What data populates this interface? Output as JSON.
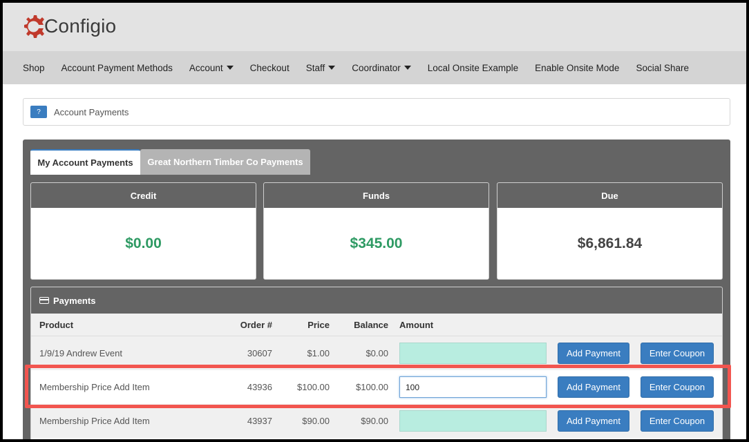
{
  "brand": {
    "name": "Configio",
    "color": "#c0392b"
  },
  "nav": {
    "items": [
      {
        "label": "Shop",
        "dropdown": false
      },
      {
        "label": "Account Payment Methods",
        "dropdown": false
      },
      {
        "label": "Account",
        "dropdown": true
      },
      {
        "label": "Checkout",
        "dropdown": false
      },
      {
        "label": "Staff",
        "dropdown": true
      },
      {
        "label": "Coordinator",
        "dropdown": true
      },
      {
        "label": "Local Onsite Example",
        "dropdown": false
      },
      {
        "label": "Enable Onsite Mode",
        "dropdown": false
      },
      {
        "label": "Social Share",
        "dropdown": false
      }
    ]
  },
  "breadcrumb": {
    "help": "?",
    "label": "Account Payments"
  },
  "tabs": [
    {
      "label": "My Account Payments",
      "active": true
    },
    {
      "label": "Great Northern Timber Co Payments",
      "active": false
    }
  ],
  "stats": {
    "credit": {
      "label": "Credit",
      "value": "$0.00"
    },
    "funds": {
      "label": "Funds",
      "value": "$345.00"
    },
    "due": {
      "label": "Due",
      "value": "$6,861.84"
    }
  },
  "payments": {
    "title": "Payments",
    "columns": {
      "product": "Product",
      "order": "Order #",
      "price": "Price",
      "balance": "Balance",
      "amount": "Amount"
    },
    "add_label": "Add Payment",
    "coupon_label": "Enter Coupon",
    "rows": [
      {
        "product": "1/9/19 Andrew Event",
        "order": "30607",
        "price": "$1.00",
        "balance": "$0.00",
        "amount": ""
      },
      {
        "product": "Membership Price Add Item",
        "order": "43936",
        "price": "$100.00",
        "balance": "$100.00",
        "amount": "100"
      },
      {
        "product": "Membership Price Add Item",
        "order": "43937",
        "price": "$90.00",
        "balance": "$90.00",
        "amount": ""
      }
    ]
  },
  "colors": {
    "accent": "#3a7dc0",
    "positive": "#2e9a63",
    "highlight": "#f2554f",
    "amount_field": "#b8ede0"
  }
}
